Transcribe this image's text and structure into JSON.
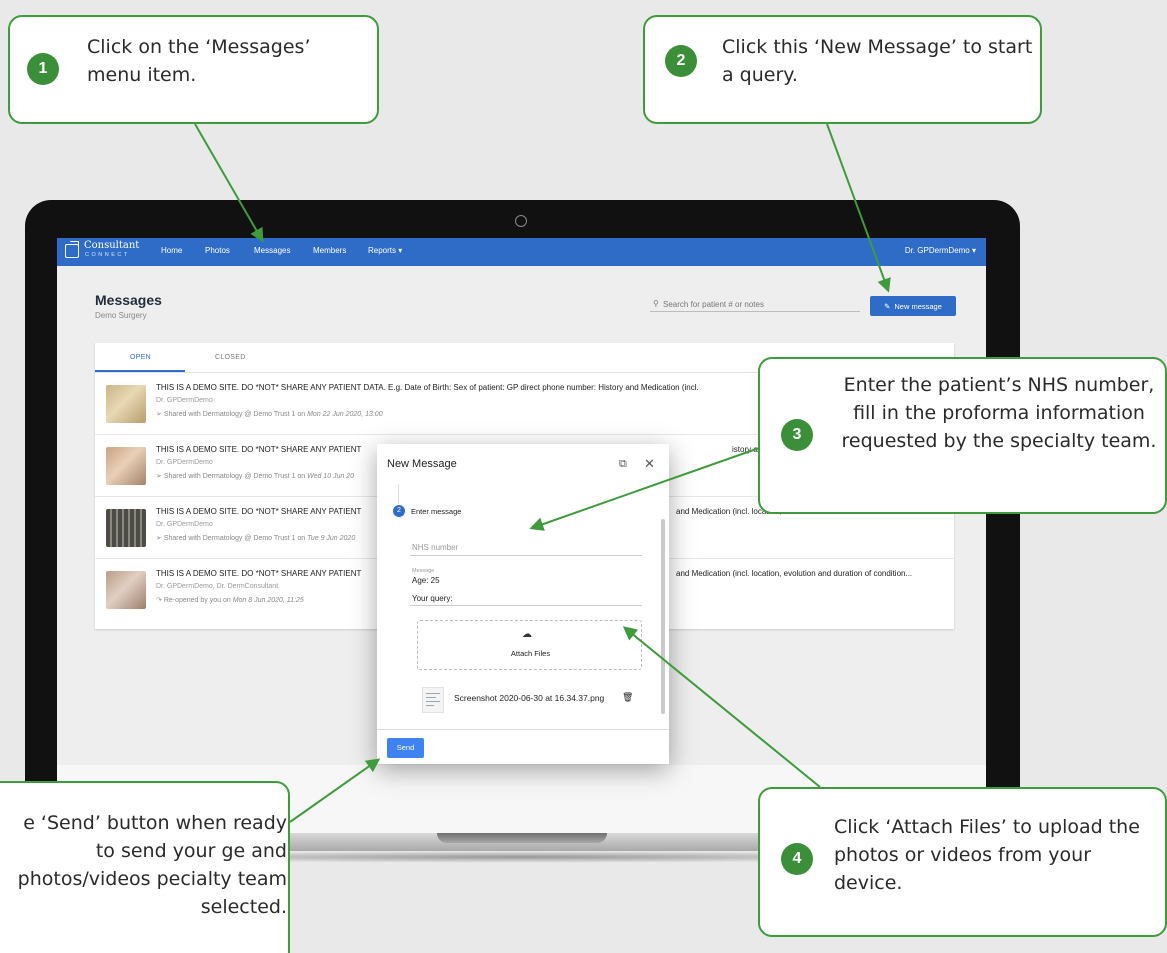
{
  "app": {
    "logo_text": "Consultant",
    "logo_sub": "CONNECT",
    "nav": [
      "Home",
      "Photos",
      "Messages",
      "Members",
      "Reports ▾"
    ],
    "user": "Dr. GPDermDemo ▾"
  },
  "page": {
    "title": "Messages",
    "subtitle": "Demo Surgery",
    "search_placeholder": "Search for patient # or notes",
    "new_message_button": "New message"
  },
  "tabs": [
    "OPEN",
    "CLOSED"
  ],
  "messages": [
    {
      "title": "THIS IS A DEMO SITE. DO *NOT* SHARE ANY PATIENT DATA. E.g. Date of Birth: Sex of patient: GP direct phone number: History and Medication (incl.",
      "author": "Dr. GPDermDemo",
      "status": "Shared with Dermatology @ Demo Trust 1 on ",
      "date": "Mon 22 Jun 2020, 13:00"
    },
    {
      "title": "THIS IS A DEMO SITE. DO *NOT* SHARE ANY PATIENT",
      "tail": "istory and Medication",
      "author": "Dr. GPDermDemo",
      "status": "Shared with Dermatology @ Demo Trust 1 on ",
      "date": "Wed 10 Jun 20"
    },
    {
      "title": "THIS IS A DEMO SITE. DO *NOT* SHARE ANY PATIENT",
      "tail": "and Medication (incl. location, evolution and duration of condition...",
      "author": "Dr. GPDermDemo",
      "status": "Shared with Dermatology @ Demo Trust 1 on ",
      "date": "Tue 9 Jun 2020"
    },
    {
      "title": "THIS IS A DEMO SITE. DO *NOT* SHARE ANY PATIENT",
      "tail": "and Medication (incl. location, evolution and duration of condition...",
      "author": "Dr. GPDermDemo, Dr. DermConsultant",
      "status": "Re-opened by you on ",
      "date": "Mon 8 Jun 2020, 11:25"
    }
  ],
  "dialog": {
    "title": "New Message",
    "step_number": "2",
    "step_label": "Enter message",
    "nhs_placeholder": "NHS number",
    "message_label": "Message",
    "message_age": "Age: 25",
    "message_query": "Your query:",
    "attach_label": "Attach Files",
    "file_name": "Screenshot 2020-06-30 at 16.34.37.png",
    "send_button": "Send"
  },
  "callouts": [
    {
      "num": "1",
      "text": "Click on the ‘Messages’ menu item."
    },
    {
      "num": "2",
      "text": "Click this ‘New Message’ to start a query."
    },
    {
      "num": "3",
      "text": "Enter the patient’s NHS number, fill in the proforma information requested by the specialty team."
    },
    {
      "num": "4",
      "text": "Click ‘Attach Files’ to upload the photos or videos from your device."
    },
    {
      "text": "e ‘Send’ button when ready to send your ge and photos/videos pecialty team selected."
    }
  ],
  "colors": {
    "brand": "#2f6cc8",
    "callout_green": "#3f9b3c",
    "callout_badge": "#3b8f38"
  }
}
